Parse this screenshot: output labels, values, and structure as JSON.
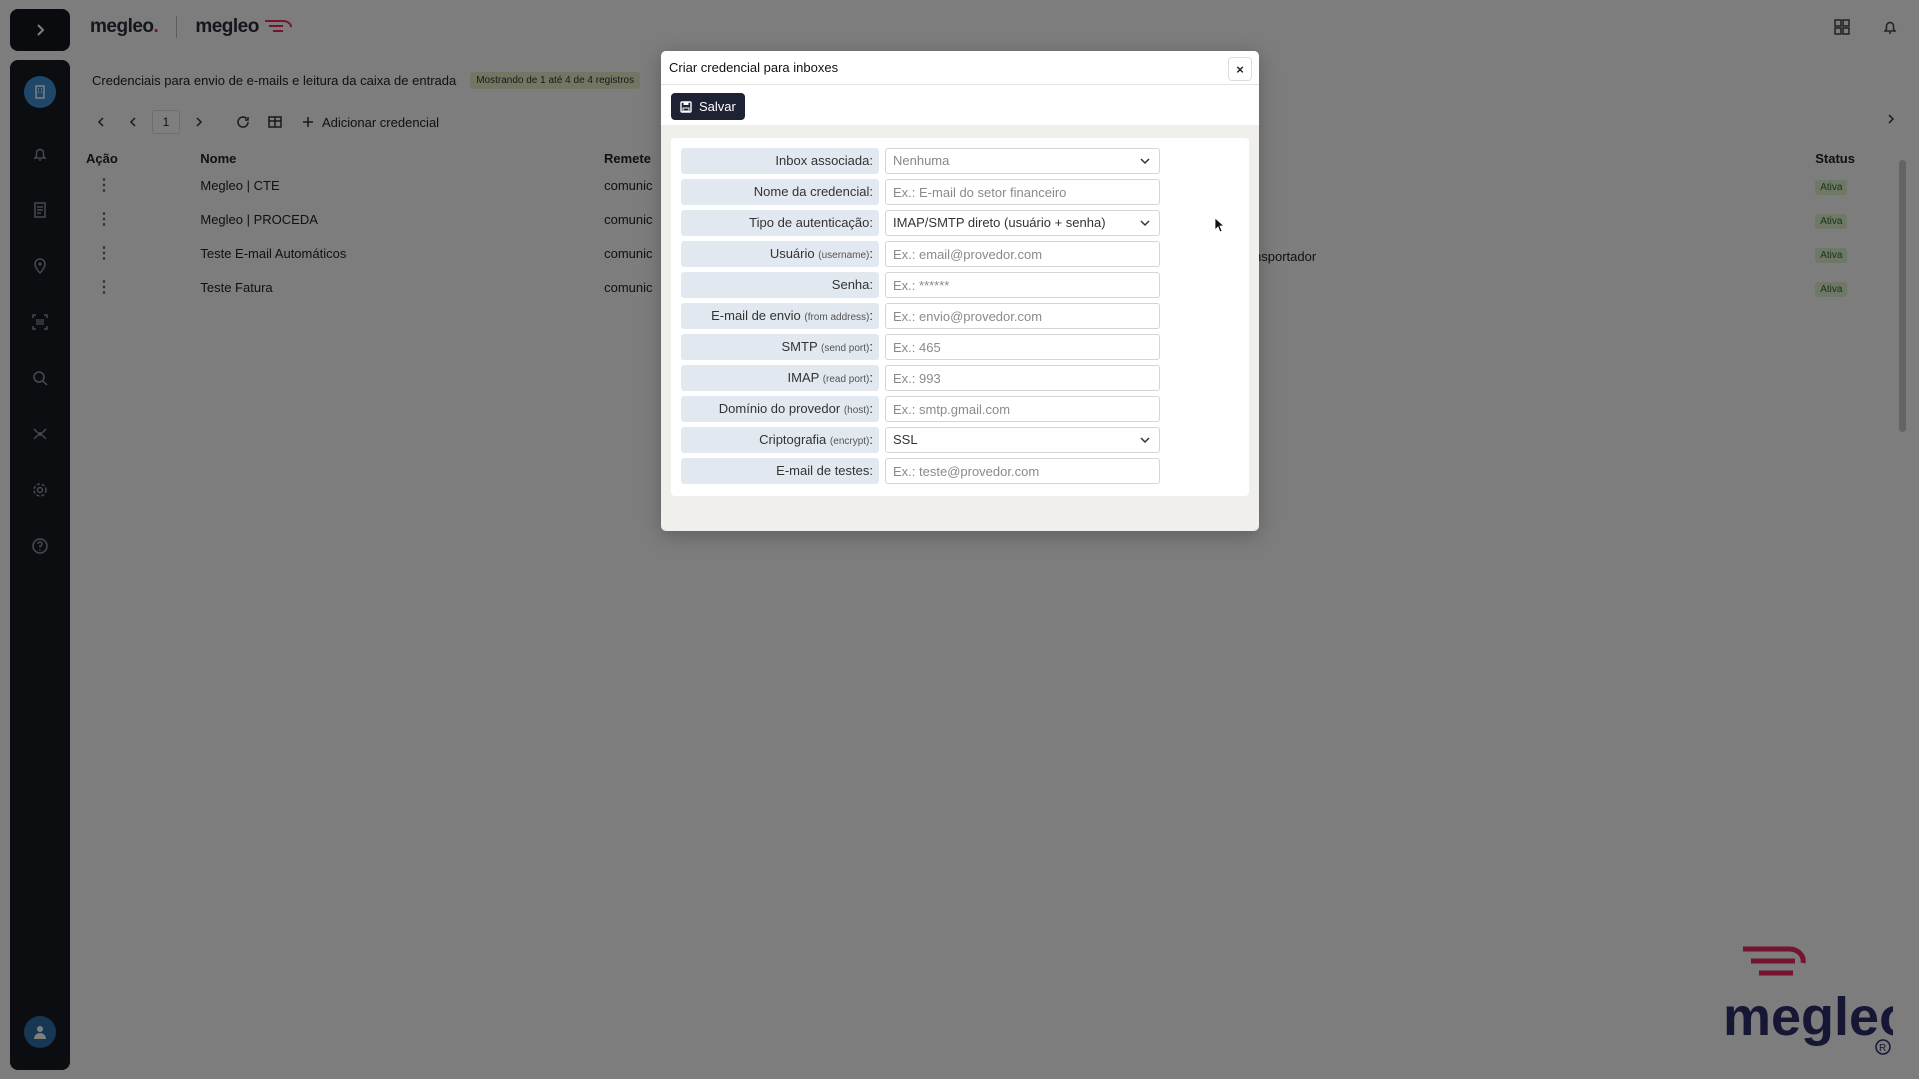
{
  "topbar": {
    "logo_primary": "megleo",
    "logo_dot": ".",
    "logo_secondary": "megleo"
  },
  "page": {
    "title": "Credenciais para envio de e-mails e leitura da caixa de entrada",
    "records_info": "Mostrando de 1 até 4 de 4 registros"
  },
  "toolbar": {
    "page_number": "1",
    "add_label": "Adicionar credencial"
  },
  "table": {
    "headers": {
      "acao": "Ação",
      "nome": "Nome",
      "remetente": "Remete",
      "status": "Status"
    },
    "rows": [
      {
        "nome": "Megleo | CTE",
        "remetente": "comunic",
        "status": "Ativa"
      },
      {
        "nome": "Megleo | PROCEDA",
        "remetente": "comunic",
        "status": "Ativa"
      },
      {
        "nome": "Teste E-mail Automáticos",
        "remetente": "comunic",
        "status": "Ativa"
      },
      {
        "nome": "Teste Fatura",
        "remetente": "comunic",
        "status": "Ativa"
      }
    ],
    "extra_text": "nsportador"
  },
  "brand": {
    "name": "megleo"
  },
  "modal": {
    "title": "Criar credencial para inboxes",
    "close_label": "×",
    "save_label": "Salvar",
    "fields": [
      {
        "label": "Inbox associada:",
        "hint": "",
        "value": "Nenhuma",
        "type": "select"
      },
      {
        "label": "Nome da credencial:",
        "hint": "",
        "placeholder": "Ex.: E-mail do setor financeiro",
        "type": "input"
      },
      {
        "label": "Tipo de autenticação:",
        "hint": "",
        "value": "IMAP/SMTP direto (usuário + senha)",
        "type": "select"
      },
      {
        "label": "Usuário",
        "hint": "(username)",
        "placeholder": "Ex.: email@provedor.com",
        "type": "input"
      },
      {
        "label": "Senha:",
        "hint": "",
        "placeholder": "Ex.: ******",
        "type": "input"
      },
      {
        "label": "E-mail de envio",
        "hint": "(from address)",
        "placeholder": "Ex.: envio@provedor.com",
        "type": "input"
      },
      {
        "label": "SMTP",
        "hint": "(send port)",
        "placeholder": "Ex.: 465",
        "type": "input"
      },
      {
        "label": "IMAP",
        "hint": "(read port)",
        "placeholder": "Ex.: 993",
        "type": "input"
      },
      {
        "label": "Domínio do provedor",
        "hint": "(host)",
        "placeholder": "Ex.: smtp.gmail.com",
        "type": "input"
      },
      {
        "label": "Criptografia",
        "hint": "(encrypt)",
        "value": "SSL",
        "type": "select"
      },
      {
        "label": "E-mail de testes:",
        "hint": "",
        "placeholder": "Ex.: teste@provedor.com",
        "type": "input"
      }
    ]
  },
  "colors": {
    "sidebar": "#191b23",
    "accent": "#3d8fd4",
    "save_button": "#1e2235",
    "brand_pink": "#e8295f",
    "brand_navy": "#2c2f6b"
  }
}
